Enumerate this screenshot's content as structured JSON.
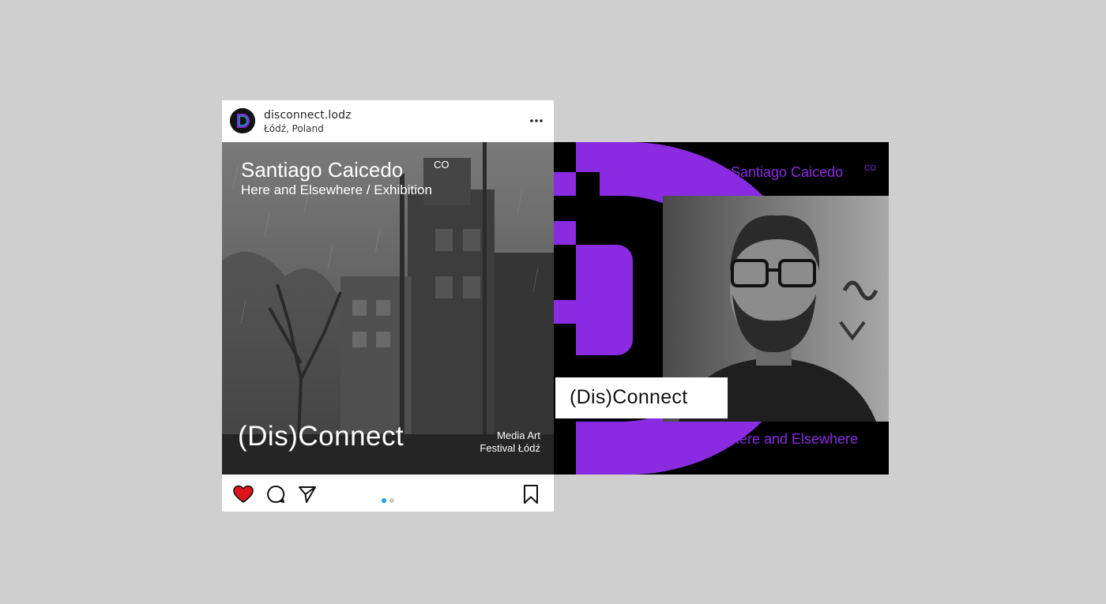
{
  "post": {
    "username": "disconnect.lodz",
    "location": "Łódź, Poland"
  },
  "slide1": {
    "title": "Santiago Caicedo",
    "country": "CO",
    "subtitle": "Here and Elsewhere / Exhibition",
    "logo": "(Dis)Connect",
    "festival_line1": "Media Art",
    "festival_line2": "Festival Łódź"
  },
  "slide2": {
    "title": "Santiago Caicedo",
    "country": "CO",
    "subtitle": "Here and Elsewhere",
    "logo": "(Dis)Connect"
  },
  "carousel": {
    "current": 1,
    "total": 2
  },
  "icons": {
    "like": "heart-icon",
    "comment": "comment-icon",
    "share": "send-icon",
    "save": "bookmark-icon",
    "more": "more-icon"
  },
  "colors": {
    "background": "#cfcfcf",
    "brand_purple": "#8a2be2",
    "like_red": "#e0151b",
    "dot_active": "#1ea1d6",
    "dot_inactive": "#c9c9c9"
  }
}
